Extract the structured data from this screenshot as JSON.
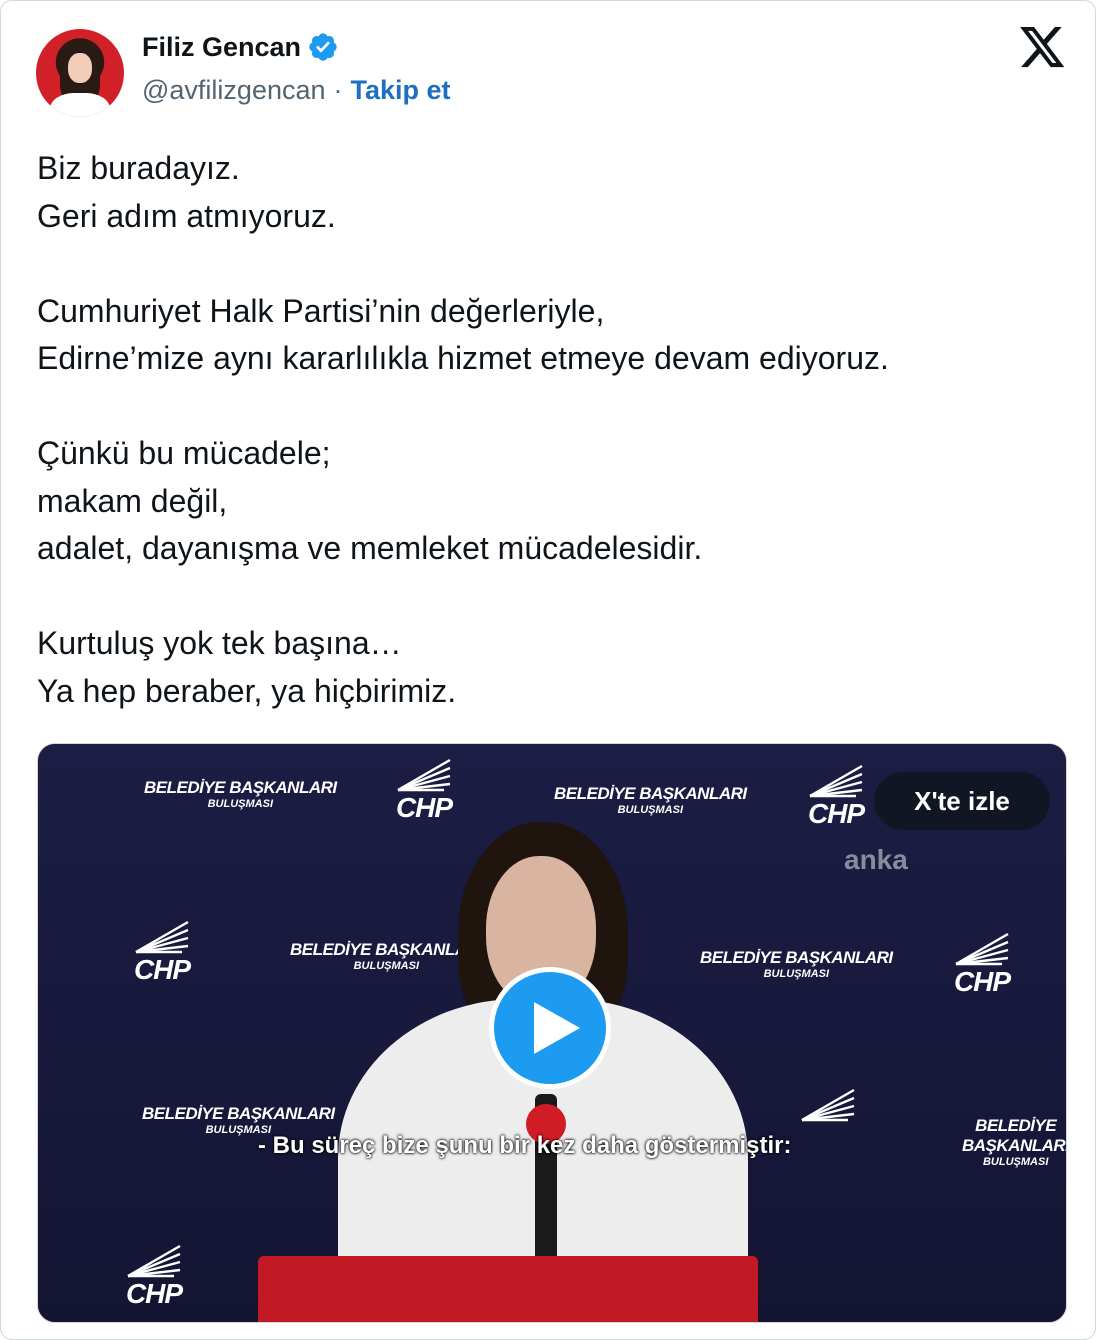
{
  "author": {
    "name": "Filiz Gencan",
    "handle": "@avfilizgencan",
    "separator": "·",
    "follow_label": "Takip et"
  },
  "icons": {
    "verified": "verified-badge-icon",
    "platform": "x-logo-icon",
    "play": "play-icon"
  },
  "colors": {
    "follow_link": "#1d6fc2",
    "verified": "#1d9bf0",
    "play_button": "#1d9bf0"
  },
  "tweet": {
    "lines": [
      "Biz buradayız.",
      "Geri adım atmıyoruz.",
      "",
      "Cumhuriyet Halk Partisi’nin değerleriyle,",
      "Edirne’mize aynı kararlılıkla hizmet etmeye devam ediyoruz.",
      "",
      "Çünkü bu mücadele;",
      "makam değil,",
      "adalet, dayanışma ve memleket mücadelesidir.",
      "",
      "Kurtuluş yok tek başına…",
      "Ya hep beraber, ya hiçbirimiz."
    ]
  },
  "video": {
    "watch_label": "X'te izle",
    "subtitle": "- Bu süreç bize şunu bir kez daha göstermiştir:",
    "backdrop": {
      "banner_line1": "BELEDİYE BAŞKANLARI",
      "banner_line2": "BULUŞMASI",
      "party_logo": "CHP",
      "agency_watermark": "anka"
    }
  }
}
